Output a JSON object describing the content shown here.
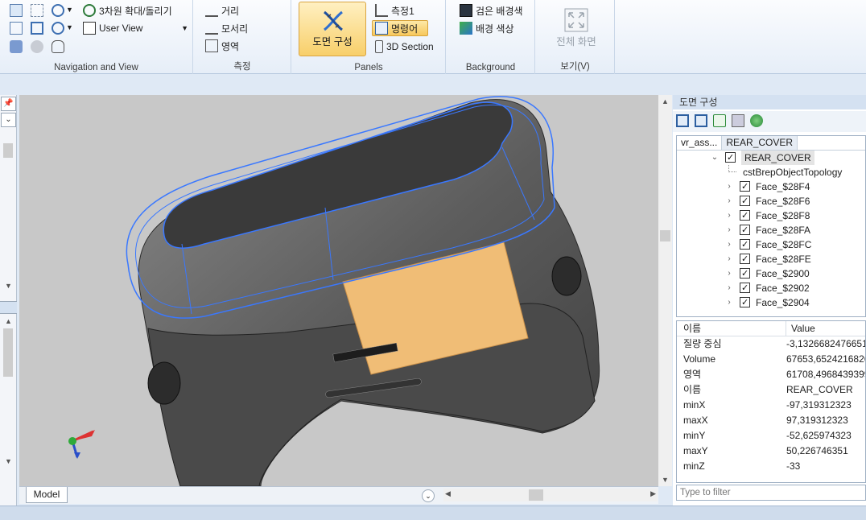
{
  "ribbon": {
    "navigation": {
      "label": "Navigation and View",
      "zoom3d": "3차원 확대/돌리기",
      "user_view": "User View"
    },
    "measure": {
      "label": "측정",
      "distance": "거리",
      "edge": "모서리",
      "area": "영역"
    },
    "panels": {
      "label": "Panels",
      "drawing_config": "도면 구성",
      "measure1": "측정1",
      "command": "명령어",
      "section": "3D Section"
    },
    "background": {
      "label": "Background",
      "black_bg": "검은 배경색",
      "bg_color": "배경 색상"
    },
    "view": {
      "label": "보기(V)",
      "fullscreen": "전체 화면"
    }
  },
  "viewport": {
    "tab": "Model"
  },
  "right_panel": {
    "title": "도면 구성",
    "breadcrumbs": [
      "vr_ass...",
      "REAR_COVER"
    ],
    "tree": {
      "root": "REAR_COVER",
      "topology": "cstBrepObjectTopology",
      "faces": [
        "Face_$28F4",
        "Face_$28F6",
        "Face_$28F8",
        "Face_$28FA",
        "Face_$28FC",
        "Face_$28FE",
        "Face_$2900",
        "Face_$2902",
        "Face_$2904"
      ]
    },
    "props_header": {
      "name": "이름",
      "value": "Value"
    },
    "props": [
      {
        "name": "질량 중심",
        "value": "-3,1326682476651"
      },
      {
        "name": "Volume",
        "value": "67653,6524216826"
      },
      {
        "name": "영역",
        "value": "61708,4968439399"
      },
      {
        "name": "이름",
        "value": "REAR_COVER"
      },
      {
        "name": "minX",
        "value": "-97,319312323"
      },
      {
        "name": "maxX",
        "value": "97,319312323"
      },
      {
        "name": "minY",
        "value": "-52,625974323"
      },
      {
        "name": "maxY",
        "value": "50,226746351"
      },
      {
        "name": "minZ",
        "value": "-33"
      }
    ],
    "filter_placeholder": "Type to filter"
  },
  "colors": {
    "accent": "#f7c85c",
    "selected_face": "#f0bd76",
    "wireframe": "#3a78ff",
    "model": "#5a5a5a",
    "viewport_bg": "#c8c8c8"
  }
}
